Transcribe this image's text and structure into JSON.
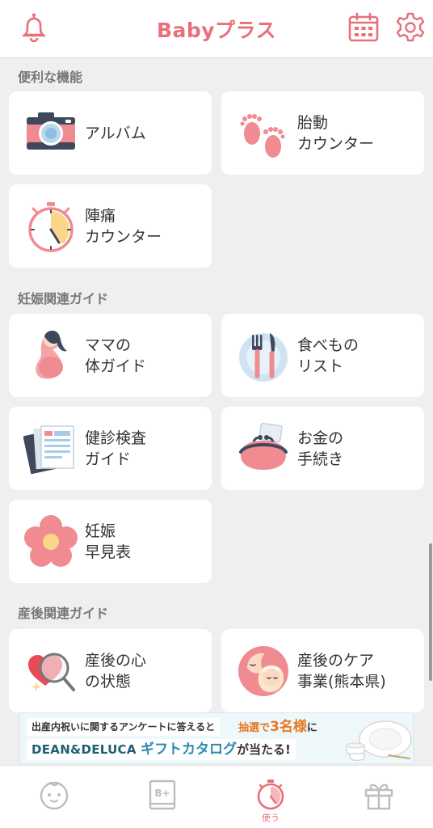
{
  "app": {
    "logo": "Babyプラス"
  },
  "header": {
    "icons": [
      "bell-icon",
      "calendar-icon",
      "gear-icon"
    ],
    "accent_color": "#e8707b"
  },
  "sections": {
    "convenience": {
      "title": "便利な機能",
      "items": [
        {
          "label": "アルバム",
          "icon": "camera-icon"
        },
        {
          "label": "胎動\nカウンター",
          "icon": "footprints-icon"
        },
        {
          "label": "陣痛\nカウンター",
          "icon": "stopwatch-icon"
        }
      ]
    },
    "pregnancy": {
      "title": "妊娠関連ガイド",
      "items": [
        {
          "label": "ママの\n体ガイド",
          "icon": "pregnant-woman-icon"
        },
        {
          "label": "食べもの\nリスト",
          "icon": "fork-knife-icon"
        },
        {
          "label": "健診検査\nガイド",
          "icon": "documents-icon"
        },
        {
          "label": "お金の\n手続き",
          "icon": "coin-purse-icon"
        },
        {
          "label": "妊娠\n早見表",
          "icon": "flower-icon"
        }
      ]
    },
    "postpartum": {
      "title": "産後関連ガイド",
      "items": [
        {
          "label": "産後の心\nの状態",
          "icon": "heart-magnifier-icon"
        },
        {
          "label": "産後のケア\n事業(熊本県)",
          "icon": "mother-baby-icon"
        }
      ]
    }
  },
  "banner": {
    "line1": "出産内祝いに関するアンケートに答えると",
    "line2_pre": "抽選で",
    "line2_num": "3名様",
    "line2_post": "に",
    "brand": "DEAN&DELUCA",
    "gift": "ギフトカタログ",
    "gift_post": "が当たる!"
  },
  "tabbar": {
    "tabs": [
      {
        "icon": "baby-face-icon",
        "label": ""
      },
      {
        "icon": "book-icon",
        "label": ""
      },
      {
        "icon": "stopwatch-tab-icon",
        "label": "使う",
        "active": true
      },
      {
        "icon": "gift-icon",
        "label": ""
      }
    ]
  }
}
